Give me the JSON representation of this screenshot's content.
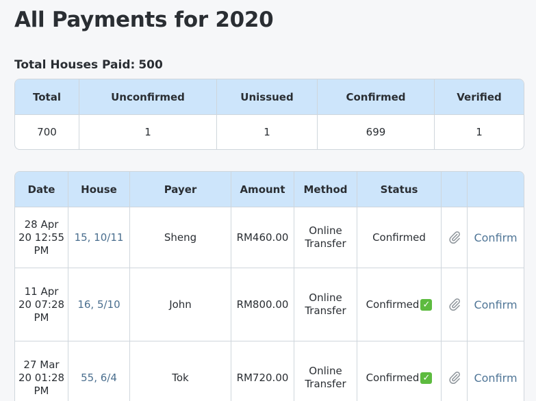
{
  "page": {
    "title": "All Payments for 2020",
    "total_houses_label": "Total Houses Paid:",
    "total_houses_value": "500"
  },
  "summary": {
    "headers": [
      "Total",
      "Unconfirmed",
      "Unissued",
      "Confirmed",
      "Verified"
    ],
    "values": [
      "700",
      "1",
      "1",
      "699",
      "1"
    ]
  },
  "payments": {
    "headers": [
      "Date",
      "House",
      "Payer",
      "Amount",
      "Method",
      "Status",
      "",
      ""
    ],
    "rows": [
      {
        "date": "28 Apr 20 12:55 PM",
        "house": "15, 10/11",
        "payer": "Sheng",
        "amount": "RM460.00",
        "method": "Online Transfer",
        "status": "Confirmed",
        "status_check": false,
        "attachment_icon": "paperclip-icon",
        "action": "Confirm"
      },
      {
        "date": "11 Apr 20 07:28 PM",
        "house": "16, 5/10",
        "payer": "John",
        "amount": "RM800.00",
        "method": "Online Transfer",
        "status": "Confirmed",
        "status_check": true,
        "attachment_icon": "paperclip-icon",
        "action": "Confirm"
      },
      {
        "date": "27 Mar 20 01:28 PM",
        "house": "55, 6/4",
        "payer": "Tok",
        "amount": "RM720.00",
        "method": "Online Transfer",
        "status": "Confirmed",
        "status_check": true,
        "attachment_icon": "paperclip-icon",
        "action": "Confirm"
      }
    ]
  },
  "colors": {
    "header_bg": "#cde5fb",
    "link": "#4a6e8e",
    "check_bg": "#5dbb3f"
  }
}
